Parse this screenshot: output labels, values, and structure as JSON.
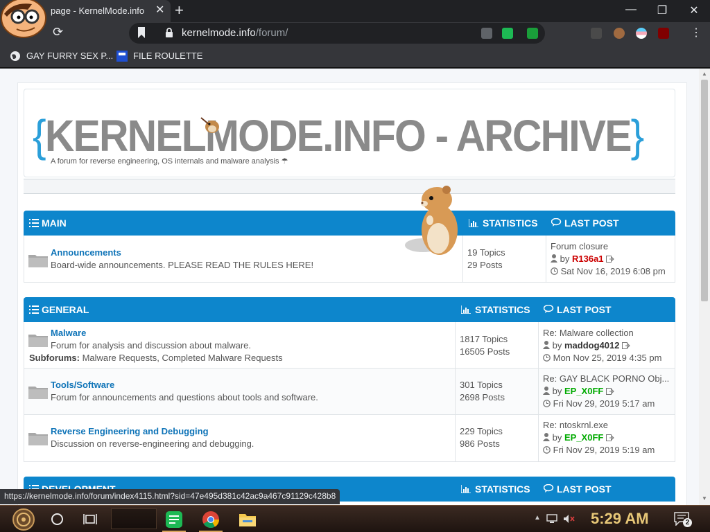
{
  "browser": {
    "tab_title": "page - KernelMode.info",
    "new_tab_symbol": "+",
    "url_host": "kernelmode.info",
    "url_path": "/forum/",
    "bookmarks": [
      {
        "label": "GAY FURRY SEX P..."
      },
      {
        "label": "FILE ROULETTE"
      }
    ],
    "status_url": "https://kernelmode.info/forum/index4115.html?sid=47e495d381c42ac9a467c91129c428b8"
  },
  "site": {
    "logo_open": "{",
    "logo_text": "KERNELMODE.INFO - ARCHIVE",
    "logo_close": "}",
    "tagline": "A forum for reverse engineering, OS internals and malware analysis ☂"
  },
  "categories": [
    {
      "title": "MAIN",
      "stats_label": "STATISTICS",
      "lastpost_label": "LAST POST",
      "forums": [
        {
          "title": "Announcements",
          "description": "Board-wide announcements. PLEASE READ THE RULES HERE!",
          "topics": "19 Topics",
          "posts": "29 Posts",
          "lp_title": "Forum closure",
          "lp_by": "by",
          "lp_user": "R136a1",
          "lp_user_color": "#cc0000",
          "lp_date": "Sat Nov 16, 2019 6:08 pm"
        }
      ]
    },
    {
      "title": "GENERAL",
      "stats_label": "STATISTICS",
      "lastpost_label": "LAST POST",
      "forums": [
        {
          "title": "Malware",
          "description": "Forum for analysis and discussion about malware.",
          "subforums_label": "Subforums:",
          "subforums": "Malware Requests, Completed Malware Requests",
          "topics": "1817 Topics",
          "posts": "16505 Posts",
          "lp_title": "Re: Malware collection",
          "lp_by": "by",
          "lp_user": "maddog4012",
          "lp_user_color": "#333333",
          "lp_date": "Mon Nov 25, 2019 4:35 pm"
        },
        {
          "title": "Tools/Software",
          "description": "Forum for announcements and questions about tools and software.",
          "topics": "301 Topics",
          "posts": "2698 Posts",
          "lp_title": "Re: GAY BLACK PORNO Obj...",
          "lp_by": "by",
          "lp_user": "EP_X0FF",
          "lp_user_color": "#00aa00",
          "lp_date": "Fri Nov 29, 2019 5:17 am"
        },
        {
          "title": "Reverse Engineering and Debugging",
          "description": "Discussion on reverse-engineering and debugging.",
          "topics": "229 Topics",
          "posts": "986 Posts",
          "lp_title": "Re: ntoskrnl.exe",
          "lp_by": "by",
          "lp_user": "EP_X0FF",
          "lp_user_color": "#00aa00",
          "lp_date": "Fri Nov 29, 2019 5:19 am"
        }
      ]
    },
    {
      "title": "DEVELOPMENT",
      "stats_label": "STATISTICS",
      "lastpost_label": "LAST POST"
    }
  ],
  "taskbar": {
    "clock": "5:29 AM",
    "notification_count": "2"
  },
  "colors": {
    "accent": "#0d86cc",
    "link": "#0f74b8",
    "logo_grey": "#8a8a8a",
    "logo_brace": "#2b9fd9"
  },
  "icons": [
    "folder-icon",
    "list-icon",
    "bar-chart-icon",
    "comments-icon",
    "user-icon",
    "clock-icon",
    "view-latest-icon",
    "lock-icon",
    "reload-icon",
    "bookmark-icon",
    "close-icon",
    "menu-icon"
  ]
}
